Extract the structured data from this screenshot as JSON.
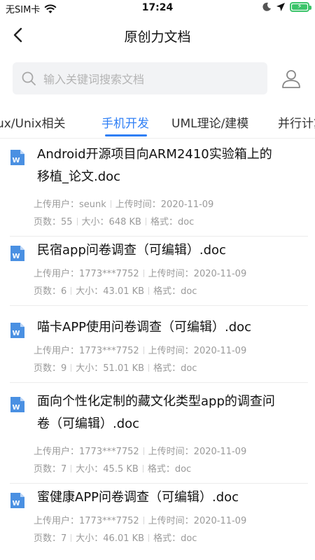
{
  "status_bar": {
    "carrier": "无SIM卡",
    "time": "17:24",
    "battery_color": "#3cc46a"
  },
  "nav": {
    "title": "原创力文档",
    "back_icon": "chevron-left-icon"
  },
  "search": {
    "placeholder": "输入关键词搜索文档",
    "icon": "search-icon",
    "profile_icon": "user-icon"
  },
  "tabs": [
    {
      "label": "Linux/Unix相关",
      "active": false
    },
    {
      "label": "手机开发",
      "active": true
    },
    {
      "label": "UML理论/建模",
      "active": false
    },
    {
      "label": "并行计算",
      "active": false
    }
  ],
  "labels": {
    "uploader": "上传用户：",
    "upload_time": "上传时间：",
    "pages": "页数：",
    "size": "大小：",
    "format": "格式："
  },
  "documents": [
    {
      "title_line1": "Android开源项目向ARM2410实验箱上的",
      "title_line2": "移植_论文.doc",
      "uploader": "seunk",
      "time": "2020-11-09",
      "pages": "55",
      "size": "648 KB",
      "format": "doc"
    },
    {
      "title_line1": "民宿app问卷调查（可编辑）.doc",
      "title_line2": "",
      "uploader": "1773***7752",
      "time": "2020-11-09",
      "pages": "6",
      "size": "43.01 KB",
      "format": "doc"
    },
    {
      "title_line1": "喵卡APP使用问卷调查（可编辑）.doc",
      "title_line2": "",
      "uploader": "1773***7752",
      "time": "2020-11-09",
      "pages": "9",
      "size": "51.01 KB",
      "format": "doc"
    },
    {
      "title_line1": "面向个性化定制的藏文化类型app的调查问",
      "title_line2": "卷（可编辑）.doc",
      "uploader": "1773***7752",
      "time": "2020-11-09",
      "pages": "7",
      "size": "45.5 KB",
      "format": "doc"
    },
    {
      "title_line1": "蜜健康APP问卷调查（可编辑）.doc",
      "title_line2": "",
      "uploader": "1773***7752",
      "time": "2020-11-09",
      "pages": "7",
      "size": "46.01 KB",
      "format": "doc"
    }
  ],
  "colors": {
    "accent": "#2f7ff5",
    "doc_icon": "#4a90e2"
  }
}
